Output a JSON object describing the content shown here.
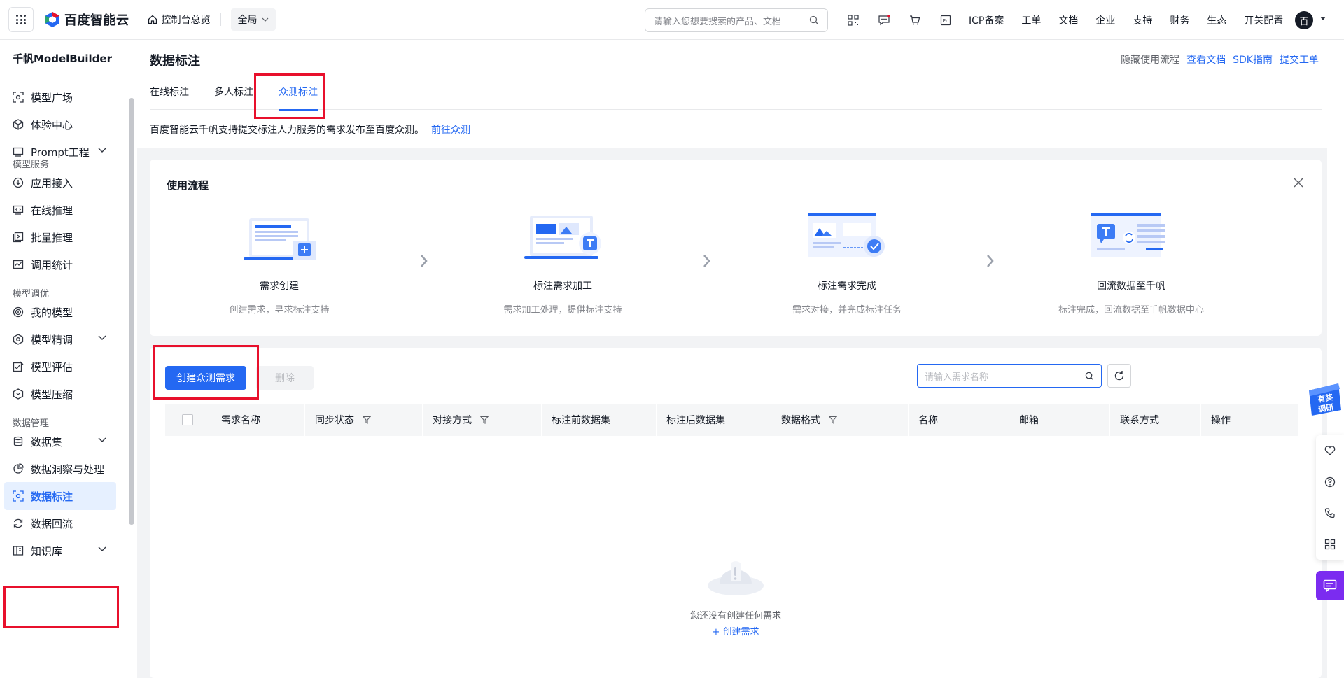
{
  "topnav": {
    "brand": "百度智能云",
    "home": "控制台总览",
    "region": "全局",
    "search_placeholder": "请输入您想要搜索的产品、文档",
    "links": [
      "ICP备案",
      "工单",
      "文档",
      "企业",
      "支持",
      "财务",
      "生态",
      "开关配置"
    ],
    "avatar": "百",
    "icons": [
      "qrcode-icon",
      "message-icon",
      "cart-icon",
      "language-icon"
    ]
  },
  "sidebar": {
    "title": "千帆ModelBuilder",
    "items": [
      {
        "label": "模型广场"
      },
      {
        "label": "体验中心"
      },
      {
        "label": "Prompt工程"
      },
      {
        "section": "模型服务"
      },
      {
        "label": "应用接入"
      },
      {
        "label": "在线推理"
      },
      {
        "label": "批量推理"
      },
      {
        "label": "调用统计"
      },
      {
        "section": "模型调优"
      },
      {
        "label": "我的模型"
      },
      {
        "label": "模型精调"
      },
      {
        "label": "模型评估"
      },
      {
        "label": "模型压缩"
      },
      {
        "section": "数据管理"
      },
      {
        "label": "数据集"
      },
      {
        "label": "数据洞察与处理"
      },
      {
        "label": "数据标注"
      },
      {
        "label": "数据回流"
      },
      {
        "label": "知识库"
      }
    ]
  },
  "main": {
    "title": "数据标注",
    "help_links": {
      "hide": "隐藏使用流程",
      "docs": "查看文档",
      "sdk": "SDK指南",
      "ticket": "提交工单"
    },
    "tabs": [
      "在线标注",
      "多人标注",
      "众测标注"
    ],
    "active_tab": "众测标注",
    "description": "百度智能云千帆支持提交标注人力服务的需求发布至百度众测。",
    "description_link": "前往众测"
  },
  "flow": {
    "title": "使用流程",
    "steps": [
      {
        "title": "需求创建",
        "desc": "创建需求，寻求标注支持"
      },
      {
        "title": "标注需求加工",
        "desc": "需求加工处理，提供标注支持"
      },
      {
        "title": "标注需求完成",
        "desc": "需求对接，并完成标注任务"
      },
      {
        "title": "回流数据至千帆",
        "desc": "标注完成，回流数据至千帆数据中心"
      }
    ]
  },
  "table": {
    "create_button": "创建众测需求",
    "delete_button": "删除",
    "search_placeholder": "请输入需求名称",
    "columns": [
      "需求名称",
      "同步状态",
      "对接方式",
      "标注前数据集",
      "标注后数据集",
      "数据格式",
      "名称",
      "邮箱",
      "联系方式",
      "操作"
    ],
    "filter_columns": [
      "同步状态",
      "对接方式",
      "数据格式"
    ],
    "rows": [],
    "empty_text": "您还没有创建任何需求",
    "empty_link": "+ 创建需求"
  },
  "floating": {
    "survey": [
      "有奖",
      "调研"
    ]
  },
  "colors": {
    "accent": "#2468f2",
    "annotation": "#e8102c",
    "chat": "#7b2cf0"
  }
}
